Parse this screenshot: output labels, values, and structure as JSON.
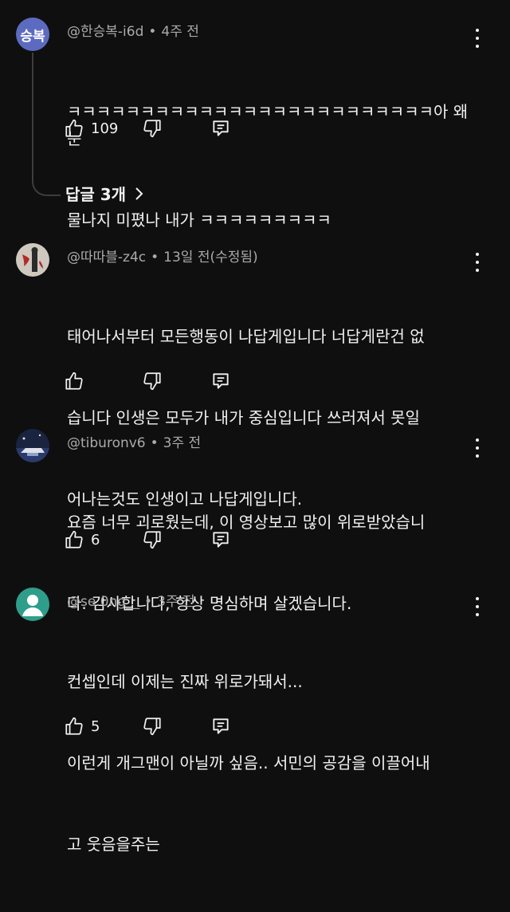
{
  "comments": [
    {
      "avatar_text": "승복",
      "handle": "@한승복-i6d",
      "time": "4주 전",
      "lines": [
        "ㅋㅋㅋㅋㅋㅋㅋㅋㅋㅋㅋㅋㅋㅋㅋㅋㅋㅋㅋㅋㅋㅋㅋㅋㅋ아 왜 눈",
        "물나지 미폈나 내가 ㅋㅋㅋㅋㅋㅋㅋㅋㅋ"
      ],
      "likes": "109",
      "replies_label": "답글 3개"
    },
    {
      "handle": "@따따블-z4c",
      "time": "13일 전(수정됨)",
      "lines": [
        "태어나서부터 모든행동이 나답게입니다 너답게란건 없",
        "습니다 인생은 모두가 내가 중심입니다 쓰러져서 못일",
        "어나는것도 인생이고 나답게입니다."
      ],
      "likes": ""
    },
    {
      "handle": "@tiburonv6",
      "time": "3주 전",
      "lines": [
        "요즘 너무 괴로웠는데, 이 영상보고 많이 위로받았습니",
        "다. 감사합니다, 항상 명심하며 살겠습니다."
      ],
      "likes": "6"
    },
    {
      "handle": "@se.0ng__",
      "time": "3주 전",
      "lines": [
        "컨셉인데 이제는 진짜 위로가돼서...",
        "이런게 개그맨이 아닐까 싶음.. 서민의 공감을 이끌어내",
        "고 웃음을주는"
      ],
      "likes": "5"
    }
  ],
  "icons": {
    "like": "thumbs-up-icon",
    "dislike": "thumbs-down-icon",
    "reply": "reply-icon",
    "more": "more-vert-icon",
    "chevron": "chevron-right-icon"
  },
  "colors": {
    "background": "#0f0f0f",
    "text": "#f1f1f1",
    "meta": "#aaaaaa",
    "avatar1": "#5c6bc0",
    "avatar4": "#2e9e8a"
  }
}
